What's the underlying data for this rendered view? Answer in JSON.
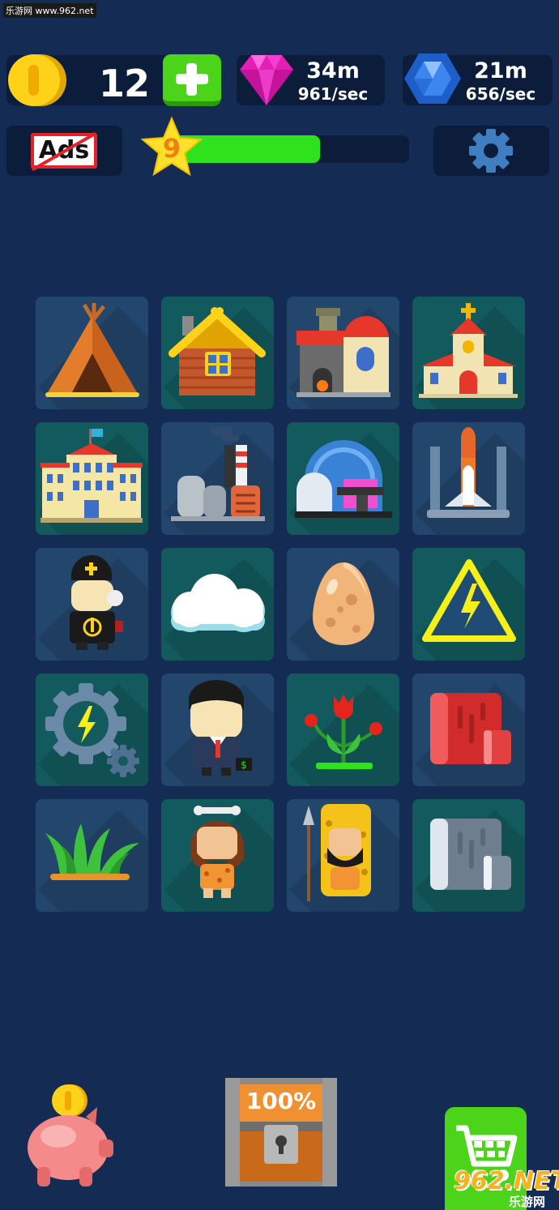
{
  "watermark_top": "乐游网 www.962.net",
  "coins": {
    "count": "12",
    "icon": "gold-coin-icon",
    "add_icon": "plus-icon"
  },
  "pink_gem": {
    "amount": "34m",
    "rate": "961/sec",
    "icon": "pink-diamond-icon"
  },
  "blue_gem": {
    "amount": "21m",
    "rate": "656/sec",
    "icon": "blue-hexagon-gem-icon"
  },
  "ads": {
    "label": "Ads",
    "icon": "no-ads-icon"
  },
  "level": {
    "number": "9",
    "progress": 0.62,
    "icon": "star-icon"
  },
  "settings": {
    "icon": "gear-icon"
  },
  "items": [
    {
      "name": "teepee",
      "icon": "teepee-icon"
    },
    {
      "name": "log-cabin",
      "icon": "log-cabin-icon"
    },
    {
      "name": "forge-house",
      "icon": "forge-house-icon"
    },
    {
      "name": "church",
      "icon": "church-icon"
    },
    {
      "name": "palace",
      "icon": "palace-icon"
    },
    {
      "name": "factory",
      "icon": "factory-icon"
    },
    {
      "name": "observatory",
      "icon": "observatory-icon"
    },
    {
      "name": "space-shuttle",
      "icon": "space-shuttle-icon"
    },
    {
      "name": "priest",
      "icon": "priest-icon"
    },
    {
      "name": "cloud",
      "icon": "cloud-icon"
    },
    {
      "name": "egg",
      "icon": "egg-icon"
    },
    {
      "name": "electricity-warning",
      "icon": "high-voltage-sign-icon"
    },
    {
      "name": "energy-gear",
      "icon": "energy-gear-icon"
    },
    {
      "name": "businessman",
      "icon": "businessman-icon"
    },
    {
      "name": "red-flowers",
      "icon": "flower-icon"
    },
    {
      "name": "red-fabric",
      "icon": "red-block-icon"
    },
    {
      "name": "grass",
      "icon": "grass-icon"
    },
    {
      "name": "caveman",
      "icon": "caveman-icon"
    },
    {
      "name": "hunter",
      "icon": "hunter-icon"
    },
    {
      "name": "stone",
      "icon": "stone-block-icon"
    }
  ],
  "piggy_bank": {
    "icon": "piggy-bank-icon"
  },
  "chest": {
    "label": "100%",
    "icon": "treasure-chest-icon"
  },
  "shop": {
    "icon": "shopping-cart-icon"
  },
  "watermark_bottom": {
    "big": "962.NET",
    "small": "乐游网"
  },
  "colors": {
    "background": "#142c54",
    "tile_blue": "#23466d",
    "tile_teal": "#135a5e",
    "accent_green": "#4bd41a",
    "xp_green": "#2ee31b"
  }
}
